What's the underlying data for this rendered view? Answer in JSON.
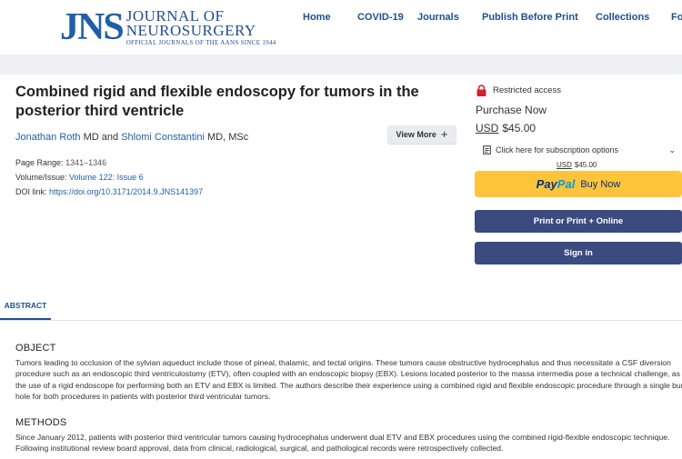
{
  "header": {
    "logo": {
      "mark": "JNS",
      "line1": "JOURNAL OF",
      "line2": "NEUROSURGERY",
      "line3": "OFFICIAL JOURNALS OF THE AANS SINCE 1944"
    },
    "nav": [
      "Home",
      "COVID-19",
      "Journals",
      "Publish Before Print",
      "Collections",
      "For"
    ]
  },
  "article": {
    "title": "Combined rigid and flexible endoscopy for tumors in the posterior third ventricle",
    "authors": [
      {
        "name": "Jonathan Roth",
        "suffix": "MD"
      },
      {
        "name": "Shlomi Constantini",
        "suffix": "MD, MSc"
      }
    ],
    "author_joiner": "and",
    "view_more": "View More",
    "page_range_label": "Page Range:",
    "page_range": "1341–1346",
    "volume_label": "Volume/Issue:",
    "volume": "Volume 122: Issue 6",
    "doi_label": "DOI link:",
    "doi": "https://doi.org/10.3171/2014.9.JNS141397"
  },
  "purchase": {
    "restricted": "Restricted access",
    "title": "Purchase Now",
    "currency": "USD",
    "price": "$45.00",
    "sub_options": "Click here for subscription options",
    "sub_currency": "USD",
    "sub_price": "$45.00",
    "paypal_pay": "Pay",
    "paypal_pal": "Pal",
    "paypal_buy": "Buy Now",
    "print_btn": "Print or Print + Online",
    "signin_btn": "Sign in"
  },
  "tabs": [
    "ABSTRACT"
  ],
  "abstract": {
    "object_head": "OBJECT",
    "object_text": "Tumors leading to occlusion of the sylvian aqueduct include those of pineal, thalamic, and tectal origins. These tumors cause obstructive hydrocephalus and thus necessitate a CSF diversion procedure such as an endoscopic third ventriculostomy (ETV), often coupled with an endoscopic biopsy (EBX). Lesions located posterior to the massa intermedia pose a technical challenge, as the use of a rigid endoscope for performing both an ETV and EBX is limited. The authors describe their experience using a combined rigid and flexible endoscopic procedure through a single bur hole for both procedures in patients with posterior third ventricular tumors.",
    "methods_head": "METHODS",
    "methods_text": "Since January 2012, patients with posterior third ventricular tumors causing hydrocephalus underwent dual ETV and EBX procedures using the combined rigid-flexible endoscopic technique. Following institutional review board approval, data from clinical, radiological, surgical, and pathological records were retrospectively collected."
  },
  "colors": {
    "brand": "#1f5fa6",
    "button_dark": "#3b4b80",
    "paypal": "#ffc439",
    "lock": "#d0202a"
  }
}
